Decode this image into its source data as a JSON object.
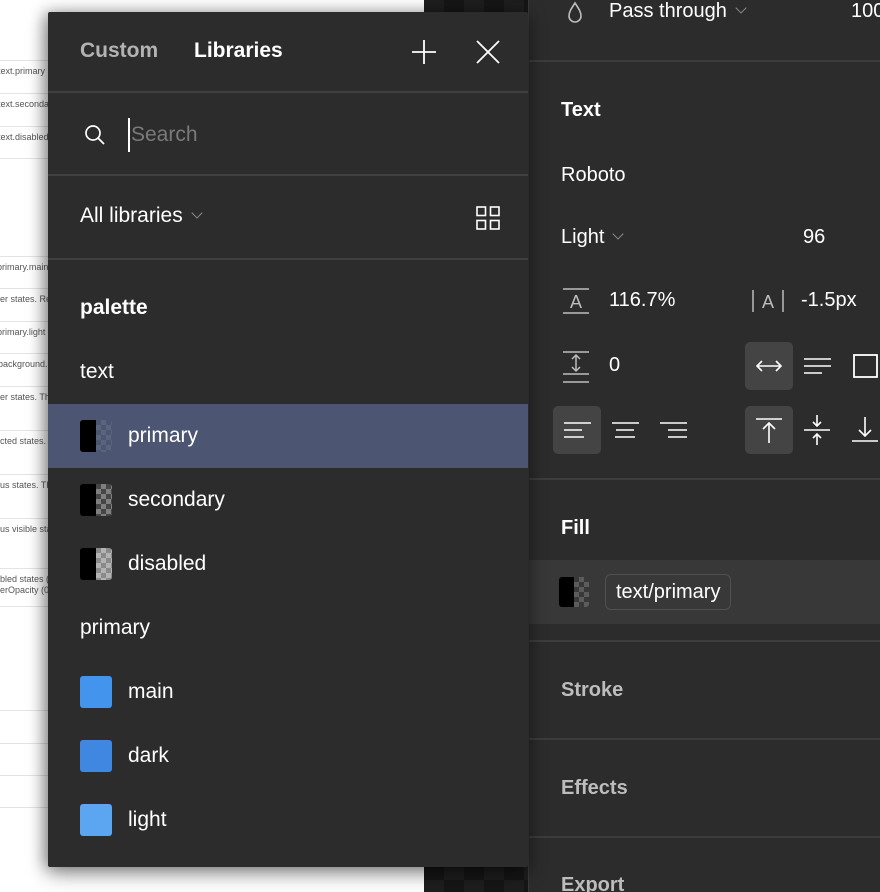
{
  "document": {
    "rows": [
      {
        "text": "text.primary",
        "top": 0
      },
      {
        "text": "text.secondary"
      },
      {
        "text": "text.disabled"
      },
      {
        "text": "primary.main"
      },
      {
        "text": "er states. Re"
      },
      {
        "text": "primary.light"
      },
      {
        "text": "background."
      },
      {
        "text": "er states. Th"
      },
      {
        "text": "cted states."
      },
      {
        "text": "us states. Th"
      },
      {
        "text": "us visible sta"
      },
      {
        "text": "bled states (",
        "text2": "erOpacity (0"
      }
    ]
  },
  "panel": {
    "tabs": [
      "Custom",
      "Libraries"
    ],
    "active_tab": "Libraries",
    "add_icon": "plus-icon",
    "close_icon": "close-icon",
    "search": {
      "placeholder": "Search",
      "value": ""
    },
    "filter": {
      "label": "All libraries",
      "view_icon": "grid-view-icon"
    },
    "list": [
      {
        "type": "group",
        "label": "palette",
        "bold": true
      },
      {
        "type": "group",
        "label": "text"
      },
      {
        "type": "style",
        "label": "primary",
        "swatch": "text-primary",
        "selected": true
      },
      {
        "type": "style",
        "label": "secondary",
        "swatch": "text-secondary"
      },
      {
        "type": "style",
        "label": "disabled",
        "swatch": "text-disabled"
      },
      {
        "type": "group",
        "label": "primary"
      },
      {
        "type": "style",
        "label": "main",
        "color": "#4394ec"
      },
      {
        "type": "style",
        "label": "dark",
        "color": "#3f87e0"
      },
      {
        "type": "style",
        "label": "light",
        "color": "#5ca5f1"
      }
    ]
  },
  "sidebar": {
    "layer": {
      "blend_mode": "Pass through",
      "opacity": "100"
    },
    "text_section": {
      "title": "Text",
      "font_family": "Roboto",
      "font_weight": "Light",
      "font_size": "96",
      "line_height": "116.7%",
      "letter_spacing": "-1.5px",
      "paragraph_spacing": "0"
    },
    "fill_section": {
      "title": "Fill",
      "style_name": "text/primary"
    },
    "stroke_section": {
      "title": "Stroke"
    },
    "effects_section": {
      "title": "Effects"
    },
    "export_section": {
      "title": "Export"
    }
  },
  "colors": {
    "panel_bg": "#2c2c2c",
    "selected_row": "#4c5672",
    "primary_main": "#4394ec",
    "primary_dark": "#3f87e0",
    "primary_light": "#5ca5f1"
  }
}
